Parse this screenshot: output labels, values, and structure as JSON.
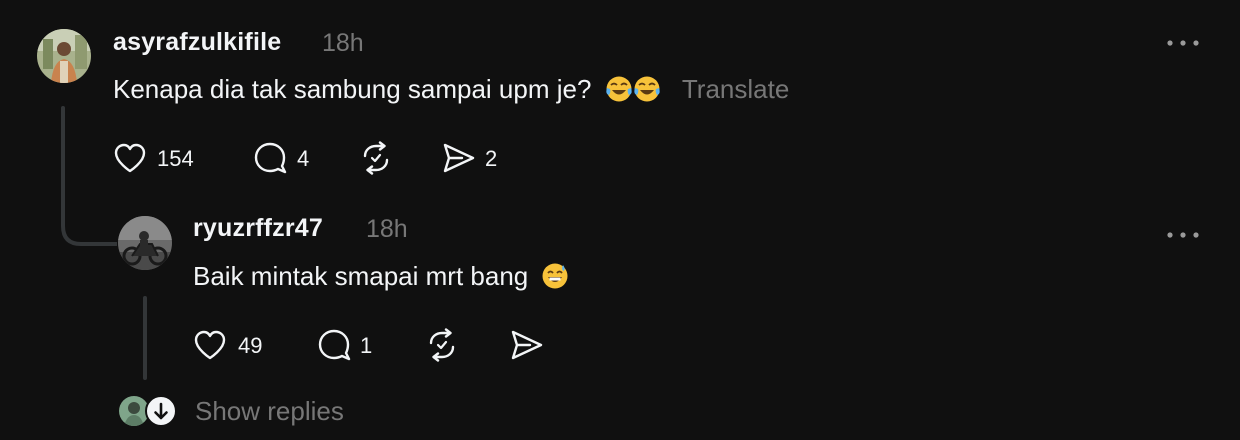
{
  "comments": [
    {
      "username": "asyrafzulkifile",
      "time": "18h",
      "text": "Kenapa dia tak sambung sampai upm je?",
      "emoji": [
        "face-with-tears-of-joy",
        "face-with-tears-of-joy"
      ],
      "translate_label": "Translate",
      "likes": "154",
      "replies": "4",
      "reposts": "",
      "shares": "2"
    },
    {
      "username": "ryuzrffzr47",
      "time": "18h",
      "text": "Baik mintak smapai mrt bang",
      "emoji": [
        "grinning-face-with-sweat"
      ],
      "likes": "49",
      "replies": "1",
      "reposts": "",
      "shares": ""
    }
  ],
  "more_label": "•••",
  "show_replies_label": "Show replies",
  "icons": [
    "heart-icon",
    "comment-icon",
    "repost-icon",
    "share-icon",
    "more-icon",
    "arrow-down-icon"
  ],
  "colors": {
    "background": "#101010",
    "primary_text": "#f3f5f7",
    "secondary_text": "#777777",
    "thread_line": "#333638"
  }
}
